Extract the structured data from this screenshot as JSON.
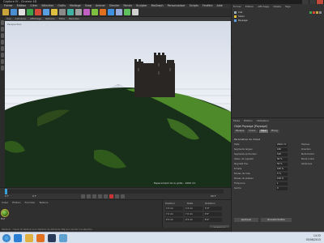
{
  "window": {
    "title": "Capture IV - Cinema 4D"
  },
  "menubar": {
    "items": [
      "Fichier",
      "Édition",
      "Créer",
      "Sélection",
      "Outils",
      "Maillage",
      "Snap",
      "Animer",
      "Simuler",
      "Rendu",
      "Sculpter",
      "MoGraph",
      "Personnaliser",
      "Scripts",
      "Fenêtre",
      "Aide"
    ]
  },
  "toolbar": {
    "icon_colors": [
      "#c8a43a",
      "#4a8fd4",
      "#e0e0e0",
      "#3fa34a",
      "#d14a3a",
      "#5aa0e0",
      "#e0c040",
      "#8a8a8a",
      "#40b0a0",
      "#a0a0a0",
      "#c060c0",
      "#80c040",
      "#e07020",
      "#4090e0",
      "#9ad",
      "#60c060",
      "#d0d0d0"
    ]
  },
  "viewport": {
    "tabs": [
      "Vue",
      "Caméras",
      "Affichage",
      "Options",
      "Filtre",
      "Panneau"
    ],
    "label": "Perspective",
    "footer": "Espacement de la grille : 1000 cm",
    "sky_color": "#e3e8f0",
    "terrain_color": "#2f5a1c"
  },
  "timeline": {
    "start": "0 F",
    "end": "90 F",
    "current": "0 F"
  },
  "materials": {
    "tabs": [
      "Créer",
      "Édition",
      "Fonction",
      "Texture"
    ],
    "material_name": "Mat"
  },
  "coordinates": {
    "headers": [
      "Position",
      "Taille",
      "Rotation"
    ],
    "rows": [
      [
        "X 0 cm",
        "X 0 cm",
        "H 0°"
      ],
      [
        "Y 0 cm",
        "Y 0 cm",
        "P 0°"
      ],
      [
        "Z 0 cm",
        "Z 0 cm",
        "B 0°"
      ]
    ],
    "apply_label": "Appliquer"
  },
  "object_manager": {
    "menu": [
      "Fichier",
      "Édition",
      "Affichage",
      "Objets",
      "Tags",
      "Signets"
    ],
    "objects": [
      "Ciel",
      "Soleil",
      "Paysage"
    ]
  },
  "attribute_manager": {
    "menu": [
      "Mode",
      "Édition",
      "Utilisateur"
    ],
    "object_title": "Objet Paysage [Paysage]",
    "tabs": [
      "Basique",
      "Coord.",
      "Objet",
      "Phong"
    ],
    "section": "Paramètres de l'objet",
    "fields": [
      {
        "label": "Taille",
        "value": "2000 cm"
      },
      {
        "label": "Segments largeur",
        "value": "100"
      },
      {
        "label": "Segments profondeur",
        "value": "100"
      },
      {
        "label": "Valeur de rugosité",
        "value": "50 %"
      },
      {
        "label": "Rugosité fine",
        "value": "50 %"
      },
      {
        "label": "Echelle",
        "value": "100 %"
      },
      {
        "label": "Niveau de l'eau",
        "value": "0 %"
      },
      {
        "label": "Niveau du plateau",
        "value": "100 %"
      },
      {
        "label": "Fréquence",
        "value": "1"
      },
      {
        "label": "Germe",
        "value": "0"
      }
    ],
    "right_fields": [
      "Hauteur",
      "Direction",
      "Multi-fractal",
      "Bords à zéro",
      "Sphérique"
    ],
    "buttons": [
      "Appliquer",
      "Nouvelle fenêtre"
    ]
  },
  "status": {
    "text": "Déplacer : cliquer et déplacer pour déplacer les éléments. MAJ pour ajouter à la sélection."
  },
  "taskbar": {
    "time": "14:32",
    "date": "05/06/2015",
    "icons": [
      "start",
      "ie",
      "explorer",
      "media",
      "c4d",
      "paint"
    ]
  }
}
